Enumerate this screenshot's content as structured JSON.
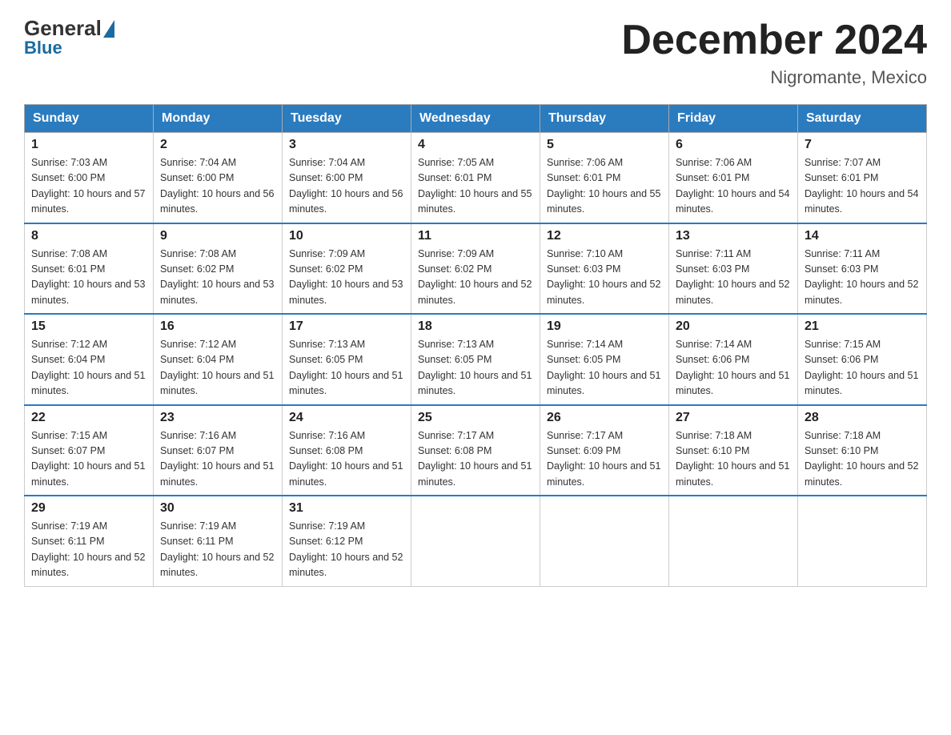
{
  "header": {
    "logo_general": "General",
    "logo_blue": "Blue",
    "main_title": "December 2024",
    "subtitle": "Nigromante, Mexico"
  },
  "days_of_week": [
    "Sunday",
    "Monday",
    "Tuesday",
    "Wednesday",
    "Thursday",
    "Friday",
    "Saturday"
  ],
  "weeks": [
    [
      {
        "day": "1",
        "sunrise": "7:03 AM",
        "sunset": "6:00 PM",
        "daylight": "10 hours and 57 minutes."
      },
      {
        "day": "2",
        "sunrise": "7:04 AM",
        "sunset": "6:00 PM",
        "daylight": "10 hours and 56 minutes."
      },
      {
        "day": "3",
        "sunrise": "7:04 AM",
        "sunset": "6:00 PM",
        "daylight": "10 hours and 56 minutes."
      },
      {
        "day": "4",
        "sunrise": "7:05 AM",
        "sunset": "6:01 PM",
        "daylight": "10 hours and 55 minutes."
      },
      {
        "day": "5",
        "sunrise": "7:06 AM",
        "sunset": "6:01 PM",
        "daylight": "10 hours and 55 minutes."
      },
      {
        "day": "6",
        "sunrise": "7:06 AM",
        "sunset": "6:01 PM",
        "daylight": "10 hours and 54 minutes."
      },
      {
        "day": "7",
        "sunrise": "7:07 AM",
        "sunset": "6:01 PM",
        "daylight": "10 hours and 54 minutes."
      }
    ],
    [
      {
        "day": "8",
        "sunrise": "7:08 AM",
        "sunset": "6:01 PM",
        "daylight": "10 hours and 53 minutes."
      },
      {
        "day": "9",
        "sunrise": "7:08 AM",
        "sunset": "6:02 PM",
        "daylight": "10 hours and 53 minutes."
      },
      {
        "day": "10",
        "sunrise": "7:09 AM",
        "sunset": "6:02 PM",
        "daylight": "10 hours and 53 minutes."
      },
      {
        "day": "11",
        "sunrise": "7:09 AM",
        "sunset": "6:02 PM",
        "daylight": "10 hours and 52 minutes."
      },
      {
        "day": "12",
        "sunrise": "7:10 AM",
        "sunset": "6:03 PM",
        "daylight": "10 hours and 52 minutes."
      },
      {
        "day": "13",
        "sunrise": "7:11 AM",
        "sunset": "6:03 PM",
        "daylight": "10 hours and 52 minutes."
      },
      {
        "day": "14",
        "sunrise": "7:11 AM",
        "sunset": "6:03 PM",
        "daylight": "10 hours and 52 minutes."
      }
    ],
    [
      {
        "day": "15",
        "sunrise": "7:12 AM",
        "sunset": "6:04 PM",
        "daylight": "10 hours and 51 minutes."
      },
      {
        "day": "16",
        "sunrise": "7:12 AM",
        "sunset": "6:04 PM",
        "daylight": "10 hours and 51 minutes."
      },
      {
        "day": "17",
        "sunrise": "7:13 AM",
        "sunset": "6:05 PM",
        "daylight": "10 hours and 51 minutes."
      },
      {
        "day": "18",
        "sunrise": "7:13 AM",
        "sunset": "6:05 PM",
        "daylight": "10 hours and 51 minutes."
      },
      {
        "day": "19",
        "sunrise": "7:14 AM",
        "sunset": "6:05 PM",
        "daylight": "10 hours and 51 minutes."
      },
      {
        "day": "20",
        "sunrise": "7:14 AM",
        "sunset": "6:06 PM",
        "daylight": "10 hours and 51 minutes."
      },
      {
        "day": "21",
        "sunrise": "7:15 AM",
        "sunset": "6:06 PM",
        "daylight": "10 hours and 51 minutes."
      }
    ],
    [
      {
        "day": "22",
        "sunrise": "7:15 AM",
        "sunset": "6:07 PM",
        "daylight": "10 hours and 51 minutes."
      },
      {
        "day": "23",
        "sunrise": "7:16 AM",
        "sunset": "6:07 PM",
        "daylight": "10 hours and 51 minutes."
      },
      {
        "day": "24",
        "sunrise": "7:16 AM",
        "sunset": "6:08 PM",
        "daylight": "10 hours and 51 minutes."
      },
      {
        "day": "25",
        "sunrise": "7:17 AM",
        "sunset": "6:08 PM",
        "daylight": "10 hours and 51 minutes."
      },
      {
        "day": "26",
        "sunrise": "7:17 AM",
        "sunset": "6:09 PM",
        "daylight": "10 hours and 51 minutes."
      },
      {
        "day": "27",
        "sunrise": "7:18 AM",
        "sunset": "6:10 PM",
        "daylight": "10 hours and 51 minutes."
      },
      {
        "day": "28",
        "sunrise": "7:18 AM",
        "sunset": "6:10 PM",
        "daylight": "10 hours and 52 minutes."
      }
    ],
    [
      {
        "day": "29",
        "sunrise": "7:19 AM",
        "sunset": "6:11 PM",
        "daylight": "10 hours and 52 minutes."
      },
      {
        "day": "30",
        "sunrise": "7:19 AM",
        "sunset": "6:11 PM",
        "daylight": "10 hours and 52 minutes."
      },
      {
        "day": "31",
        "sunrise": "7:19 AM",
        "sunset": "6:12 PM",
        "daylight": "10 hours and 52 minutes."
      },
      null,
      null,
      null,
      null
    ]
  ]
}
